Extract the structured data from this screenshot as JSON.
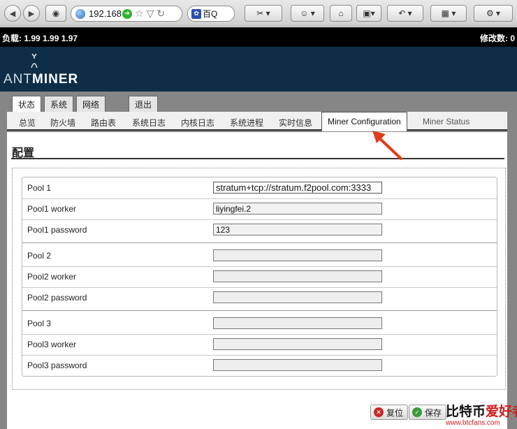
{
  "browser": {
    "url": "192.168",
    "search_placeholder": "百Q",
    "colors": {
      "toolbar": "#dcdcdc"
    }
  },
  "status_bar": {
    "load": "负载: 1.99 1.99 1.97",
    "modified": "修改数: 0"
  },
  "brand": {
    "logo_light": "ANT",
    "logo_bold": "MINER",
    "colors": {
      "header": "#0e2e47",
      "band": "#868686"
    }
  },
  "main_tabs": [
    {
      "label": "状态",
      "active": true
    },
    {
      "label": "系统",
      "active": false
    },
    {
      "label": "网络",
      "active": false
    },
    {
      "label": "退出",
      "active": false
    }
  ],
  "sub_nav": [
    {
      "label": "总览"
    },
    {
      "label": "防火墙"
    },
    {
      "label": "路由表"
    },
    {
      "label": "系统日志"
    },
    {
      "label": "内核日志"
    },
    {
      "label": "系统进程"
    },
    {
      "label": "实时信息"
    },
    {
      "label": "Miner Configuration",
      "active": true
    },
    {
      "label": "Miner Status"
    }
  ],
  "page": {
    "title": "配置",
    "fields": [
      {
        "label": "Pool 1",
        "value": "stratum+tcp://stratum.f2pool.com:3333"
      },
      {
        "label": "Pool1 worker",
        "value": "liyingfei.2"
      },
      {
        "label": "Pool1 password",
        "value": "123"
      },
      {
        "label": "Pool 2",
        "value": ""
      },
      {
        "label": "Pool2 worker",
        "value": ""
      },
      {
        "label": "Pool2 password",
        "value": ""
      },
      {
        "label": "Pool 3",
        "value": ""
      },
      {
        "label": "Pool3 worker",
        "value": ""
      },
      {
        "label": "Pool3 password",
        "value": ""
      }
    ],
    "buttons": {
      "reset": "复位",
      "save": "保存"
    }
  },
  "watermark": {
    "text_a": "比特币",
    "text_b": "爱好者",
    "site": "www.btcfans.com"
  }
}
